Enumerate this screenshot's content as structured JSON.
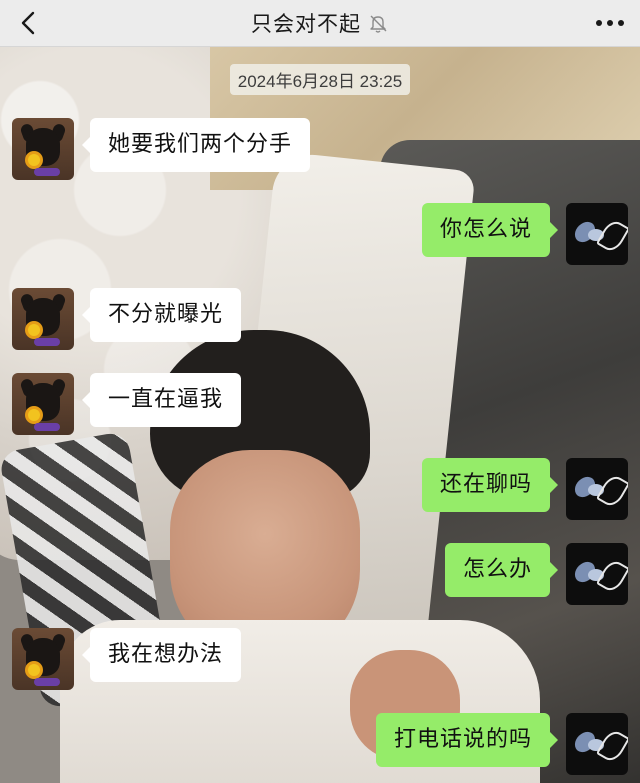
{
  "nav": {
    "title": "只会对不起",
    "back_icon": "chevron-left-icon",
    "mute_icon": "bell-muted-icon",
    "more_icon": "more-dots-icon"
  },
  "timestamp": "2024年6月28日 23:25",
  "colors": {
    "sent_bubble": "#95ec69",
    "received_bubble": "#ffffff",
    "nav_bg": "#ececec"
  },
  "messages": [
    {
      "side": "left",
      "text": "她要我们两个分手"
    },
    {
      "side": "right",
      "text": "你怎么说"
    },
    {
      "side": "left",
      "text": "不分就曝光"
    },
    {
      "side": "left",
      "text": "一直在逼我"
    },
    {
      "side": "right",
      "text": "还在聊吗"
    },
    {
      "side": "right",
      "text": "怎么办"
    },
    {
      "side": "left",
      "text": "我在想办法"
    },
    {
      "side": "right",
      "text": "打电话说的吗"
    }
  ]
}
